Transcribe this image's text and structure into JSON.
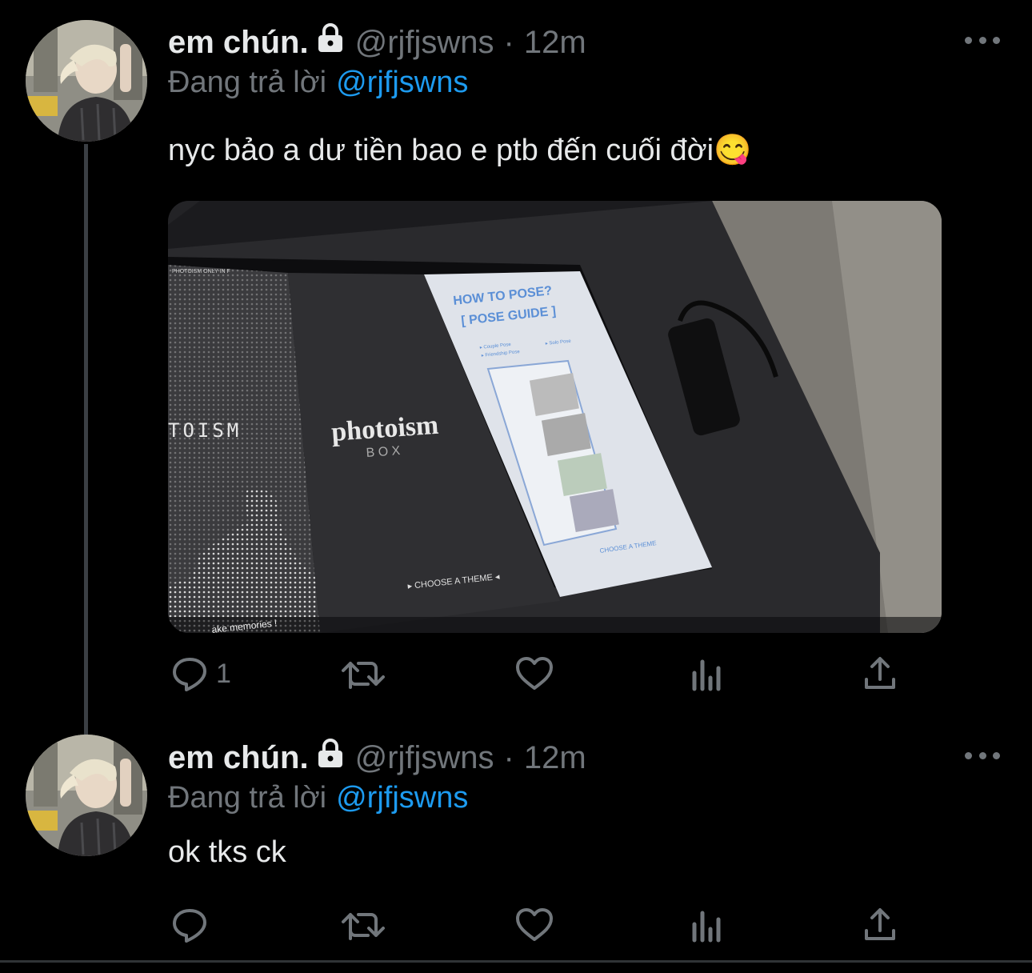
{
  "tweets": [
    {
      "display_name": "em chún.",
      "handle": "@rjfjswns",
      "separator": "·",
      "time": "12m",
      "reply_prefix": "Đang trả lời",
      "reply_mention": "@rjfjswns",
      "text": "nyc bảo a dư tiền bao e ptb đến cuối đời😋",
      "media": {
        "screen_left_text": "PHOTOISM   ONLY IN F",
        "logo": "photoism",
        "logo_sub": "B O X",
        "choose_theme": "▸ CHOOSE A THEME ◂",
        "guide_title_1": "HOW TO POSE?",
        "guide_title_2": "[ POSE GUIDE ]",
        "guide_opt_1": "▸ Couple Pose",
        "guide_opt_2": "▸ Solo Pose",
        "guide_opt_3": "▸ Friendship Pose",
        "guide_choose": "CHOOSE A THEME",
        "dots_text": "TOISM",
        "memories": "ake memories !"
      },
      "reply_count": "1"
    },
    {
      "display_name": "em chún.",
      "handle": "@rjfjswns",
      "separator": "·",
      "time": "12m",
      "reply_prefix": "Đang trả lời",
      "reply_mention": "@rjfjswns",
      "text": "ok tks ck",
      "reply_count": ""
    }
  ],
  "icons": {
    "reply": "reply-icon",
    "retweet": "retweet-icon",
    "like": "heart-icon",
    "analytics": "analytics-icon",
    "share": "share-icon",
    "more": "more-icon",
    "lock": "lock-icon"
  },
  "colors": {
    "background": "#000000",
    "text": "#e7e9ea",
    "secondary": "#71767b",
    "link": "#1d9bf0"
  }
}
